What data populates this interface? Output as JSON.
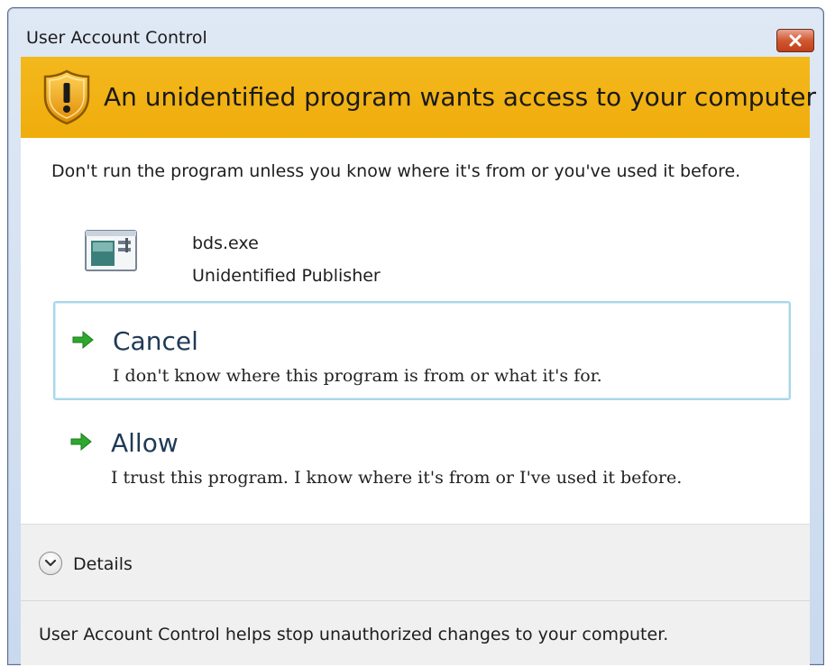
{
  "window": {
    "title": "User Account Control",
    "close_icon": "close-x-icon"
  },
  "banner": {
    "title": "An unidentified program wants access to your computer",
    "icon": "shield-warning-icon",
    "color": "#f2b316"
  },
  "message": "Don't run the program unless you know where it's from or you've used it before.",
  "program": {
    "icon": "application-icon",
    "name": "bds.exe",
    "publisher": "Unidentified Publisher"
  },
  "options": [
    {
      "title": "Cancel",
      "description": "I don't know where this program is from or what it's for.",
      "icon": "green-arrow-icon"
    },
    {
      "title": "Allow",
      "description": "I trust this program. I know where it's from or I've used it before.",
      "icon": "green-arrow-icon"
    }
  ],
  "details": {
    "label": "Details",
    "icon": "chevron-down-icon"
  },
  "footer": {
    "text": "User Account Control helps stop unauthorized changes to your computer."
  },
  "colors": {
    "accent_arrow": "#2ea82e",
    "selected_border": "#a9d7ea"
  }
}
